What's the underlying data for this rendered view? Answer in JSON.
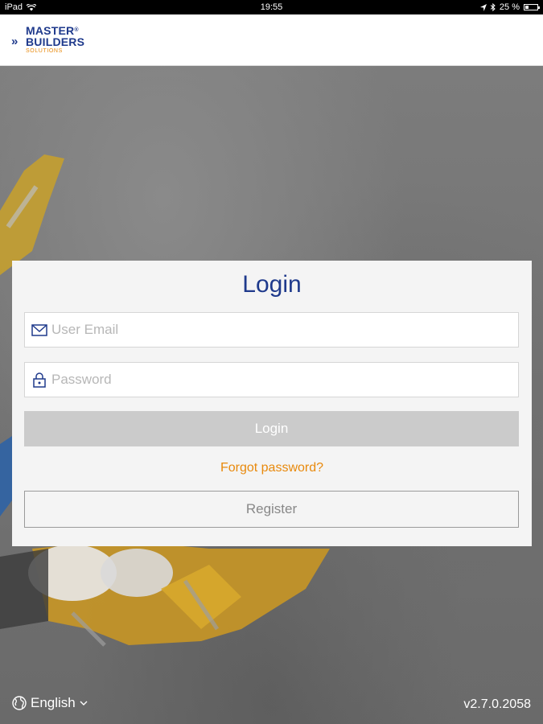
{
  "status_bar": {
    "device": "iPad",
    "time": "19:55",
    "battery": "25 %",
    "battery_level": 0.25
  },
  "header": {
    "logo": {
      "line1": "MASTER",
      "line2": "BUILDERS",
      "line3": "SOLUTIONS",
      "registered_mark": "®"
    }
  },
  "login": {
    "title": "Login",
    "email_placeholder": "User Email",
    "password_placeholder": "Password",
    "login_button": "Login",
    "forgot_link": "Forgot password?",
    "register_button": "Register"
  },
  "footer": {
    "language": "English",
    "version": "v2.7.0.2058"
  },
  "colors": {
    "brand_blue": "#1f3a8c",
    "brand_orange": "#e8890c",
    "disabled_button": "#cbcbcb"
  },
  "icons": [
    "wifi-icon",
    "location-icon",
    "bluetooth-icon",
    "battery-icon",
    "mail-icon",
    "lock-icon",
    "globe-icon",
    "chevron-down-icon"
  ]
}
